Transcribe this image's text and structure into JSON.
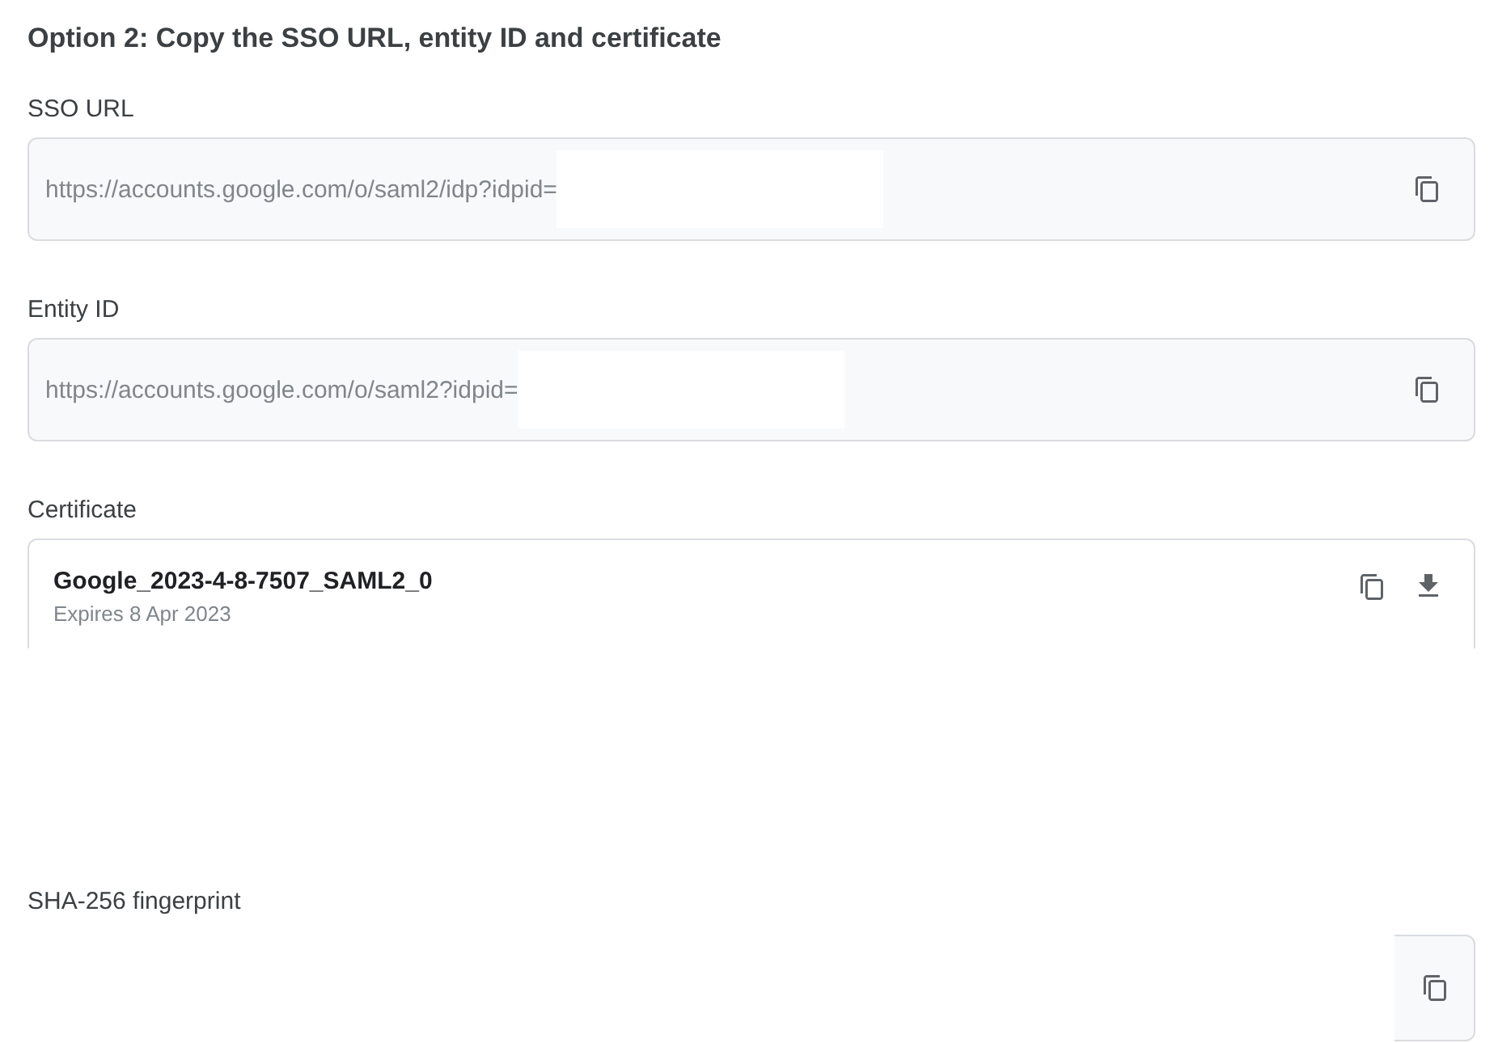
{
  "title": "Option 2: Copy the SSO URL, entity ID and certificate",
  "fields": [
    {
      "label": "SSO URL",
      "value": "https://accounts.google.com/o/saml2/idp?idpid="
    },
    {
      "label": "Entity ID",
      "value": "https://accounts.google.com/o/saml2?idpid="
    }
  ],
  "certificate": {
    "label": "Certificate",
    "name": "Google_2023-4-8-7507_SAML2_0",
    "expires": "Expires 8 Apr 2023"
  },
  "fingerprint": {
    "label": "SHA-256 fingerprint"
  }
}
